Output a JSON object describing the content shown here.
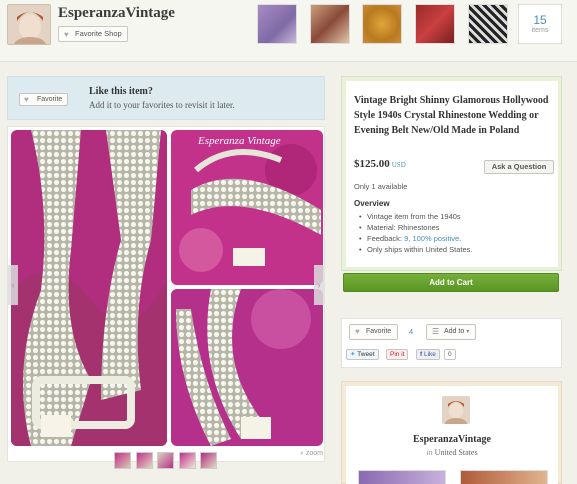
{
  "shop": {
    "name": "EsperanzaVintage",
    "favorite_shop_label": "Favorite Shop",
    "item_count": "15",
    "items_label": "items"
  },
  "favorite_bar": {
    "button_label": "Favorite",
    "title": "Like this item?",
    "subtitle": "Add it to your favorites to revisit it later."
  },
  "gallery": {
    "watermark": "Esperanza Vintage",
    "zoom_label": "zoom",
    "thumb_count": 5
  },
  "listing": {
    "title": "Vintage Bright Shinny Glamorous Hollywood Style 1940s Crystal Rhinestone Wedding or Evening Belt New/Old Made in Poland",
    "price": "$125.00",
    "currency": "USD",
    "ask_label": "Ask a Question",
    "availability": "Only 1 available",
    "overview_heading": "Overview",
    "overview": {
      "vintage": "Vintage item from the 1940s",
      "material": "Material: Rhinestones",
      "feedback_prefix": "Feedback: ",
      "feedback_link": "9, 100% positive",
      "feedback_suffix": ".",
      "shipping": "Only ships within United States."
    },
    "add_to_cart_label": "Add to Cart"
  },
  "social": {
    "favorite_label": "Favorite",
    "favorite_count": "4",
    "add_to_label": "Add to",
    "tweet_label": "Tweet",
    "pinit_label": "Pin it",
    "fb_like_label": "Like",
    "fb_count": "0"
  },
  "shop_card": {
    "name": "EsperanzaVintage",
    "in_label": "in",
    "location": "United States"
  },
  "colors": {
    "accent_blue": "#4a90b8",
    "cart_green": "#6aa530",
    "favbar_bg": "#ddebf0",
    "photo_pink": "#c2318a"
  },
  "icons": {
    "heart": "heart-icon",
    "list": "list-icon",
    "chevron": "chevron-down-icon",
    "search": "search-icon"
  }
}
